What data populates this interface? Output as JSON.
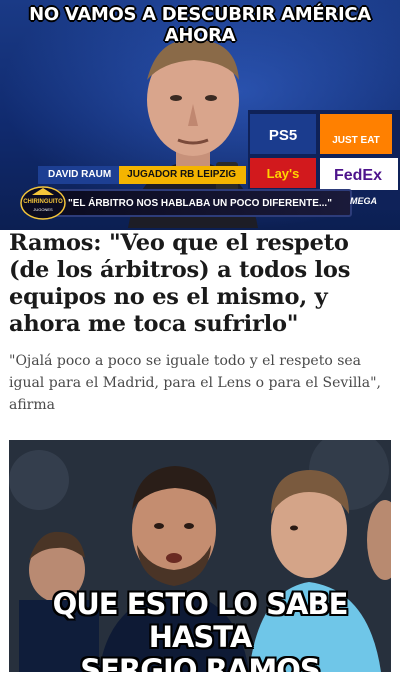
{
  "top_panel": {
    "caption": "NO VAMOS A DESCUBRIR AMÉRICA AHORA",
    "lower_third": {
      "name": "DAVID RAUM",
      "role": "JUGADOR RB LEIPZIG",
      "quote": "\"EL ÁRBITRO NOS HABLABA UN POCO DIFERENTE...\"",
      "show_logo": "CHIRINGUITO",
      "show_logo_sub": "JUGONES",
      "channel": "MEGA"
    },
    "sponsors": [
      "PS5",
      "JUST EAT",
      "Lay's",
      "FedEx"
    ]
  },
  "article": {
    "headline": "Ramos: \"Veo que el respeto (de los árbitros) a todos los equipos no es el mismo, y ahora me toca sufrirlo\"",
    "subhead": "\"Ojalá poco a poco se iguale todo y el respeto sea igual para el Madrid, para el Lens o para el Sevilla\", afirma"
  },
  "bottom_panel": {
    "caption_line1": "QUE ESTO LO SABE HASTA",
    "caption_line2": "SERGIO RAMOS"
  },
  "colors": {
    "broadcast_blue": "#1d3f93",
    "broadcast_yellow": "#f4b400",
    "headline_text": "#1a1a1a",
    "subhead_text": "#4a4a4a"
  }
}
